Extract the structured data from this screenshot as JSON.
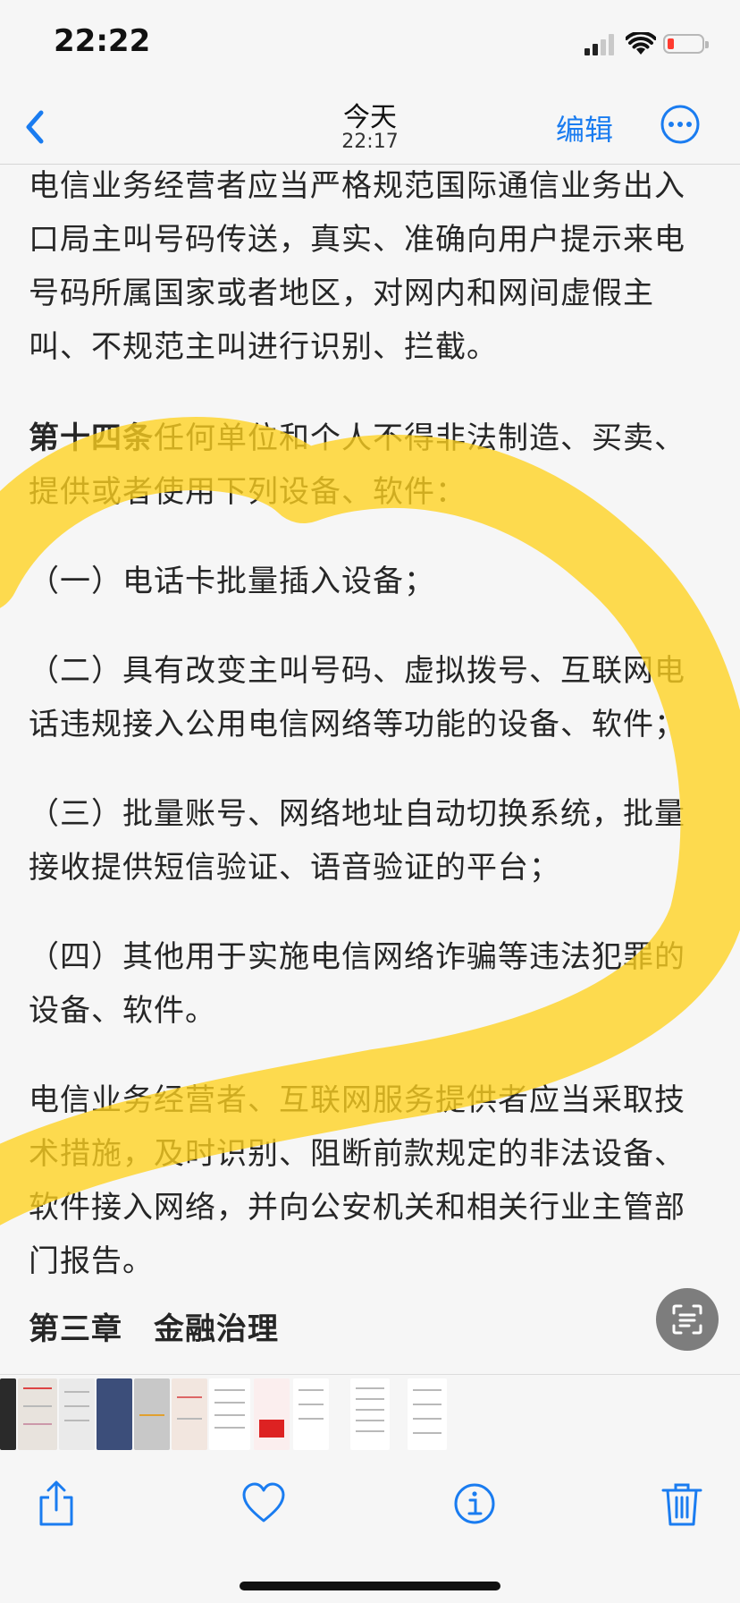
{
  "status_bar": {
    "time": "22:22"
  },
  "nav": {
    "title": "今天",
    "subtitle": "22:17",
    "edit_label": "编辑"
  },
  "document": {
    "paragraphs": [
      {
        "bold": "",
        "text": "电信业务经营者应当严格规范国际通信业务出入口局主叫号码传送，真实、准确向用户提示来电号码所属国家或者地区，对网内和网间虚假主叫、不规范主叫进行识别、拦截。"
      },
      {
        "bold": "第十四条",
        "text": "任何单位和个人不得非法制造、买卖、提供或者使用下列设备、软件："
      },
      {
        "bold": "",
        "text": "（一）电话卡批量插入设备；"
      },
      {
        "bold": "",
        "text": "（二）具有改变主叫号码、虚拟拨号、互联网电话违规接入公用电信网络等功能的设备、软件；"
      },
      {
        "bold": "",
        "text": "（三）批量账号、网络地址自动切换系统，批量接收提供短信验证、语音验证的平台；"
      },
      {
        "bold": "",
        "text": "（四）其他用于实施电信网络诈骗等违法犯罪的设备、软件。"
      },
      {
        "bold": "",
        "text": "电信业务经营者、互联网服务提供者应当采取技术措施，及时识别、阻断前款规定的非法设备、软件接入网络，并向公安机关和相关行业主管部门报告。"
      },
      {
        "bold": "第三章　金融治理",
        "text": ""
      }
    ]
  },
  "colors": {
    "accent": "#1a7cf0",
    "highlight": "#ffd21f",
    "battery_low": "#ff3b30"
  },
  "toolbar": {
    "icons": [
      "share-icon",
      "heart-icon",
      "info-icon",
      "trash-icon"
    ]
  }
}
